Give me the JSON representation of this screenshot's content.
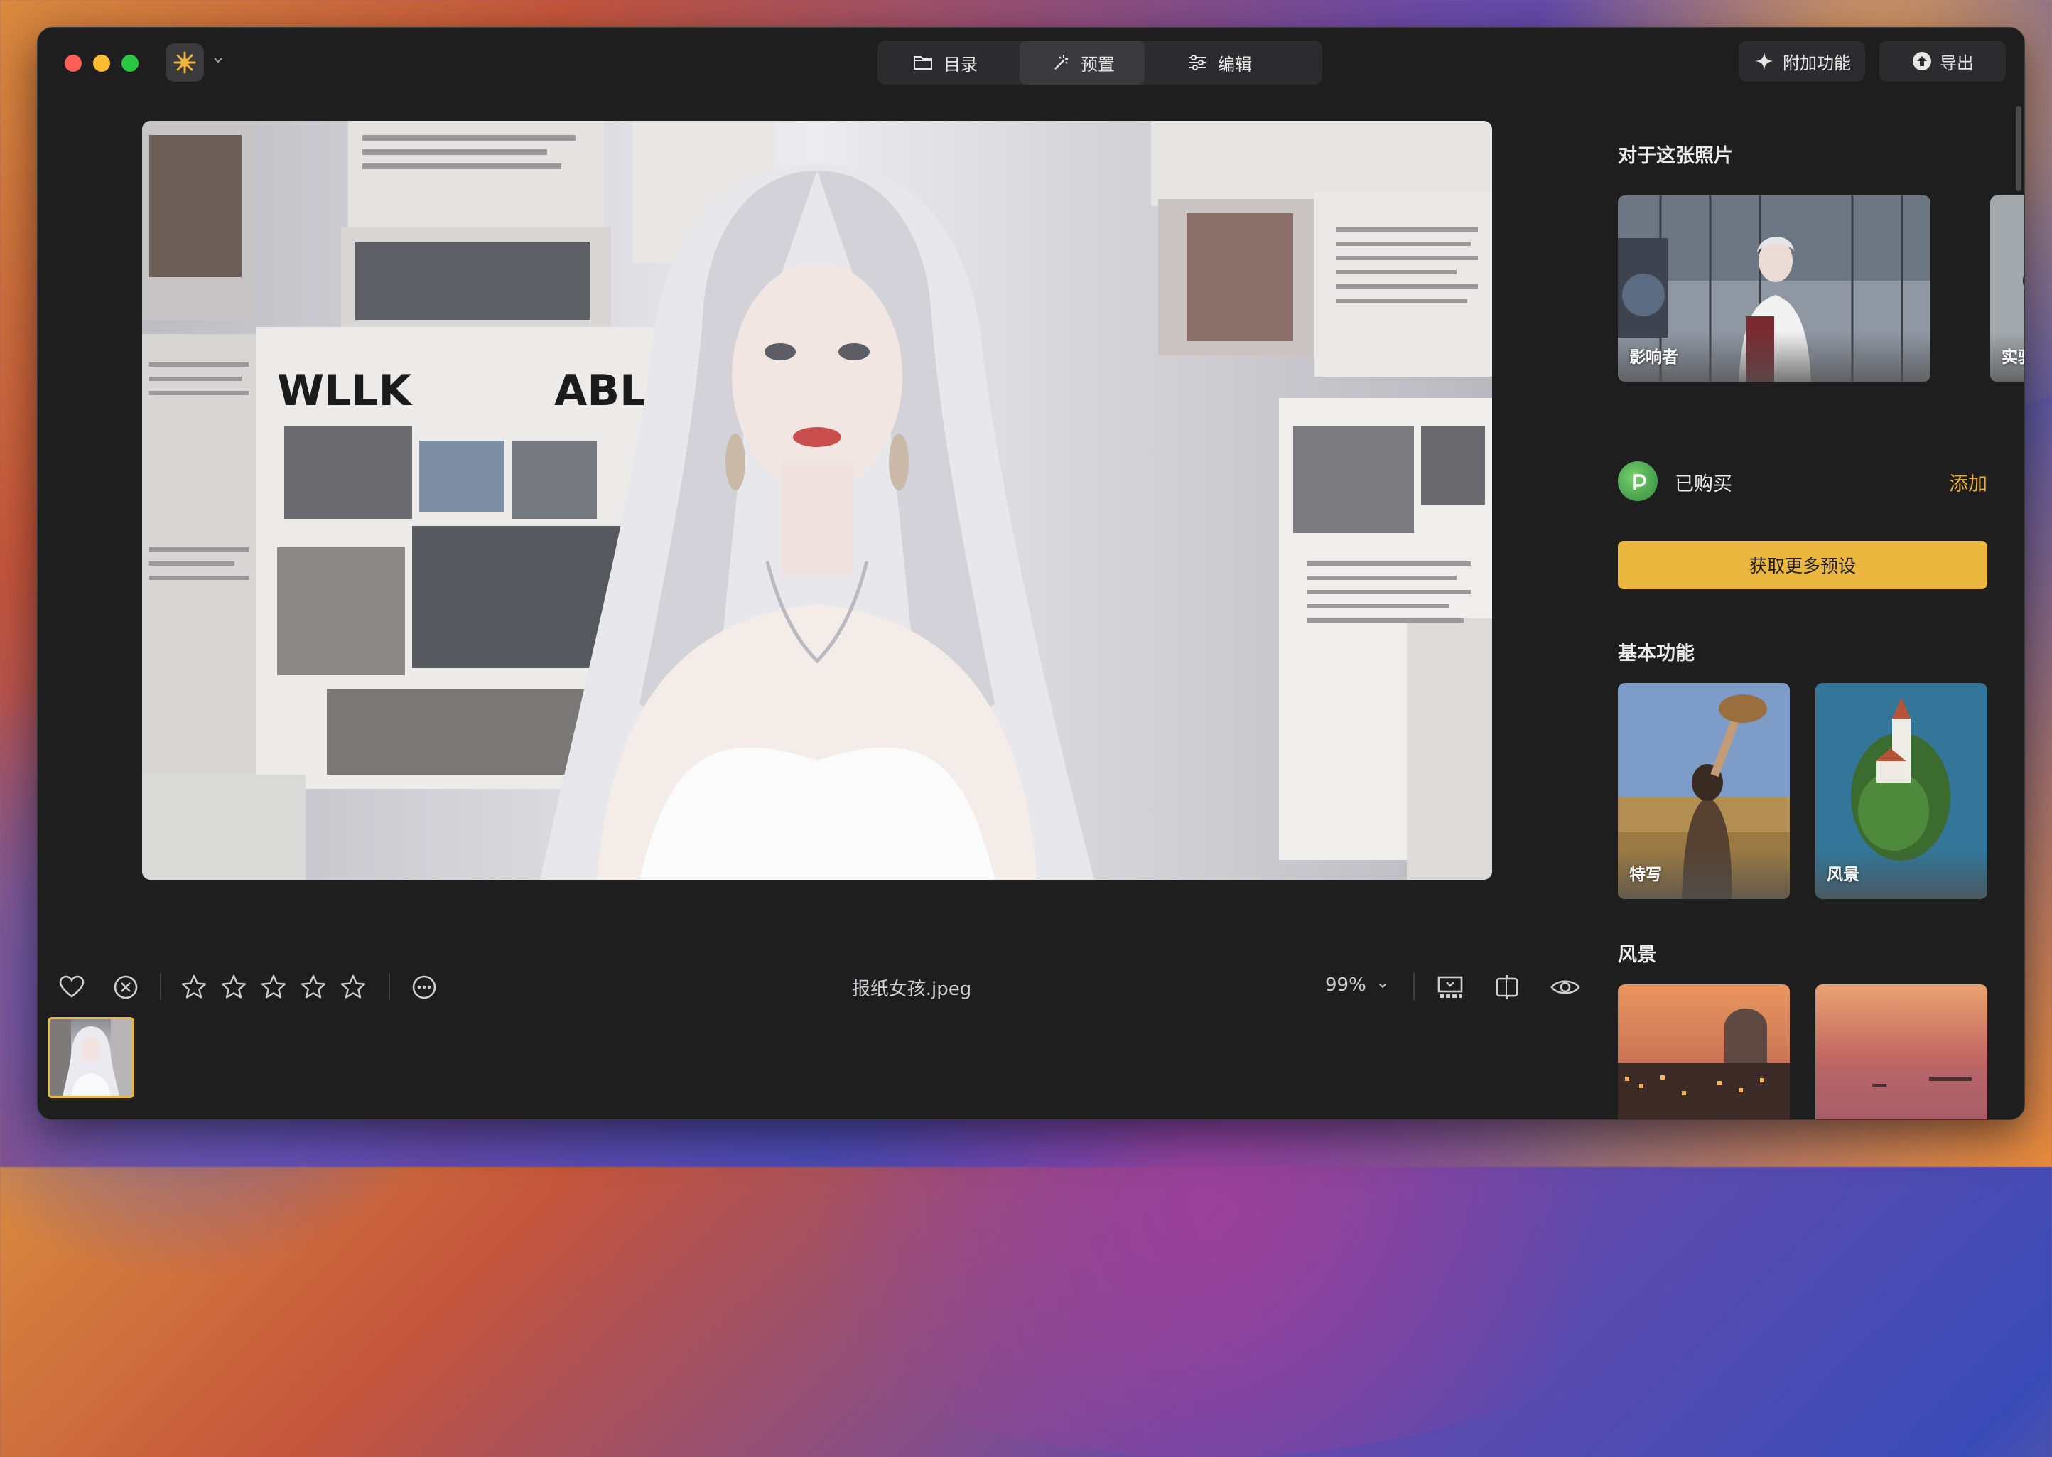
{
  "toolbar": {
    "tabs": [
      {
        "label": "目录",
        "icon": "folder-icon"
      },
      {
        "label": "预置",
        "icon": "magic-wand-icon",
        "active": true
      },
      {
        "label": "编辑",
        "icon": "sliders-icon"
      }
    ],
    "addons_label": "附加功能",
    "export_label": "导出"
  },
  "viewer": {
    "filename": "报纸女孩.jpeg",
    "zoom": "99%",
    "rating": 0,
    "rating_max": 5
  },
  "panel": {
    "about_title": "对于这张照片",
    "about_cards": [
      {
        "label": "影响者"
      },
      {
        "label": "实验"
      }
    ],
    "purchased_label": "已购买",
    "add_label": "添加",
    "get_more_label": "获取更多预设",
    "basic_title": "基本功能",
    "basic_cards": [
      {
        "label": "特写"
      },
      {
        "label": "风景"
      }
    ],
    "landscape_title": "风景"
  },
  "colors": {
    "accent": "#ECB73F",
    "window_bg": "#1E1E1F",
    "add_text": "#E8B23A"
  }
}
